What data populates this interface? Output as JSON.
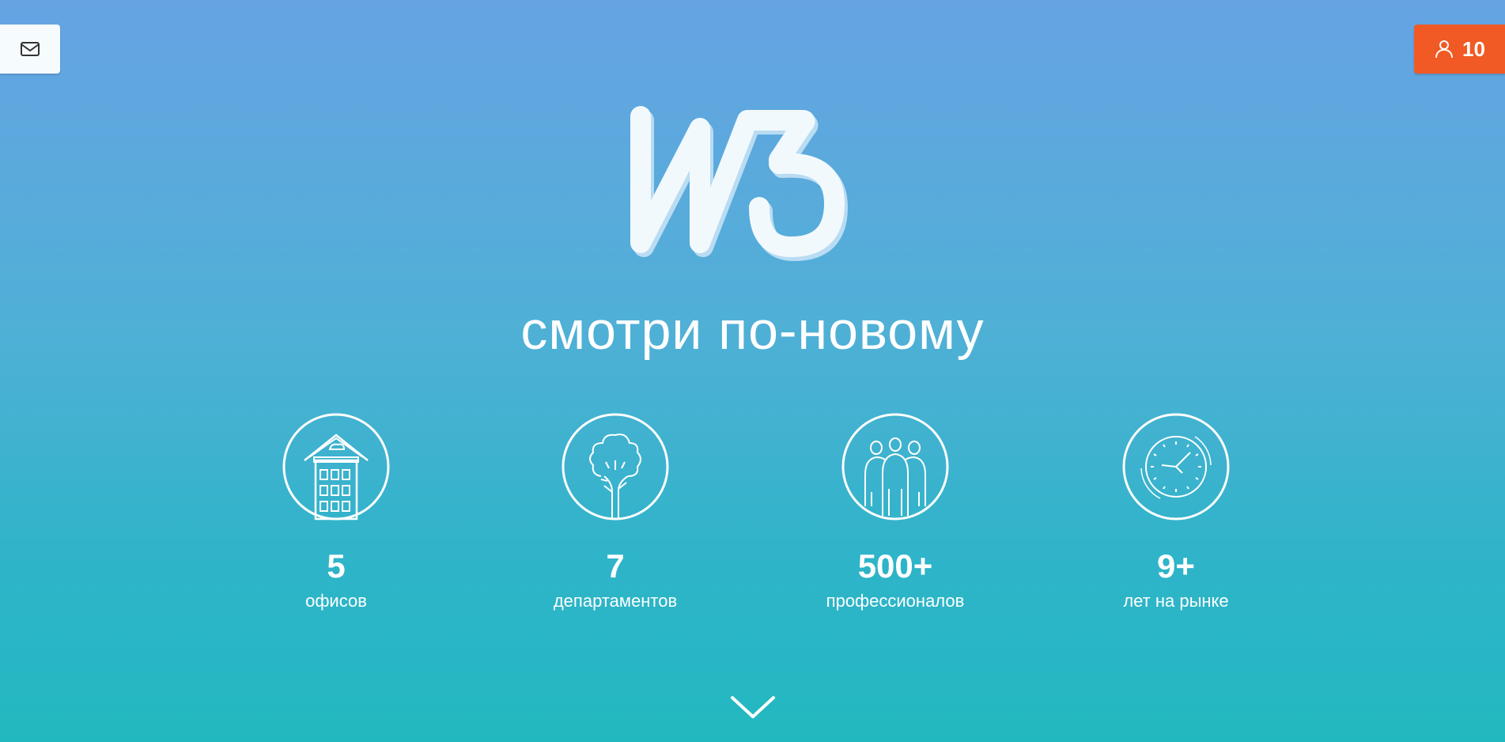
{
  "header": {
    "mail_icon": "mail-icon",
    "user_icon": "user-icon",
    "user_count": "10",
    "accent_color": "#f15a24"
  },
  "hero": {
    "logo_text": "W3",
    "tagline": "смотри по-новому"
  },
  "stats": [
    {
      "icon": "building-icon",
      "value": "5",
      "label": "офисов"
    },
    {
      "icon": "tree-icon",
      "value": "7",
      "label": "департаментов"
    },
    {
      "icon": "people-icon",
      "value": "500+",
      "label": "профессионалов"
    },
    {
      "icon": "clock-icon",
      "value": "9+",
      "label": "лет на рынке"
    }
  ],
  "scroll": {
    "icon": "chevron-down-icon"
  }
}
